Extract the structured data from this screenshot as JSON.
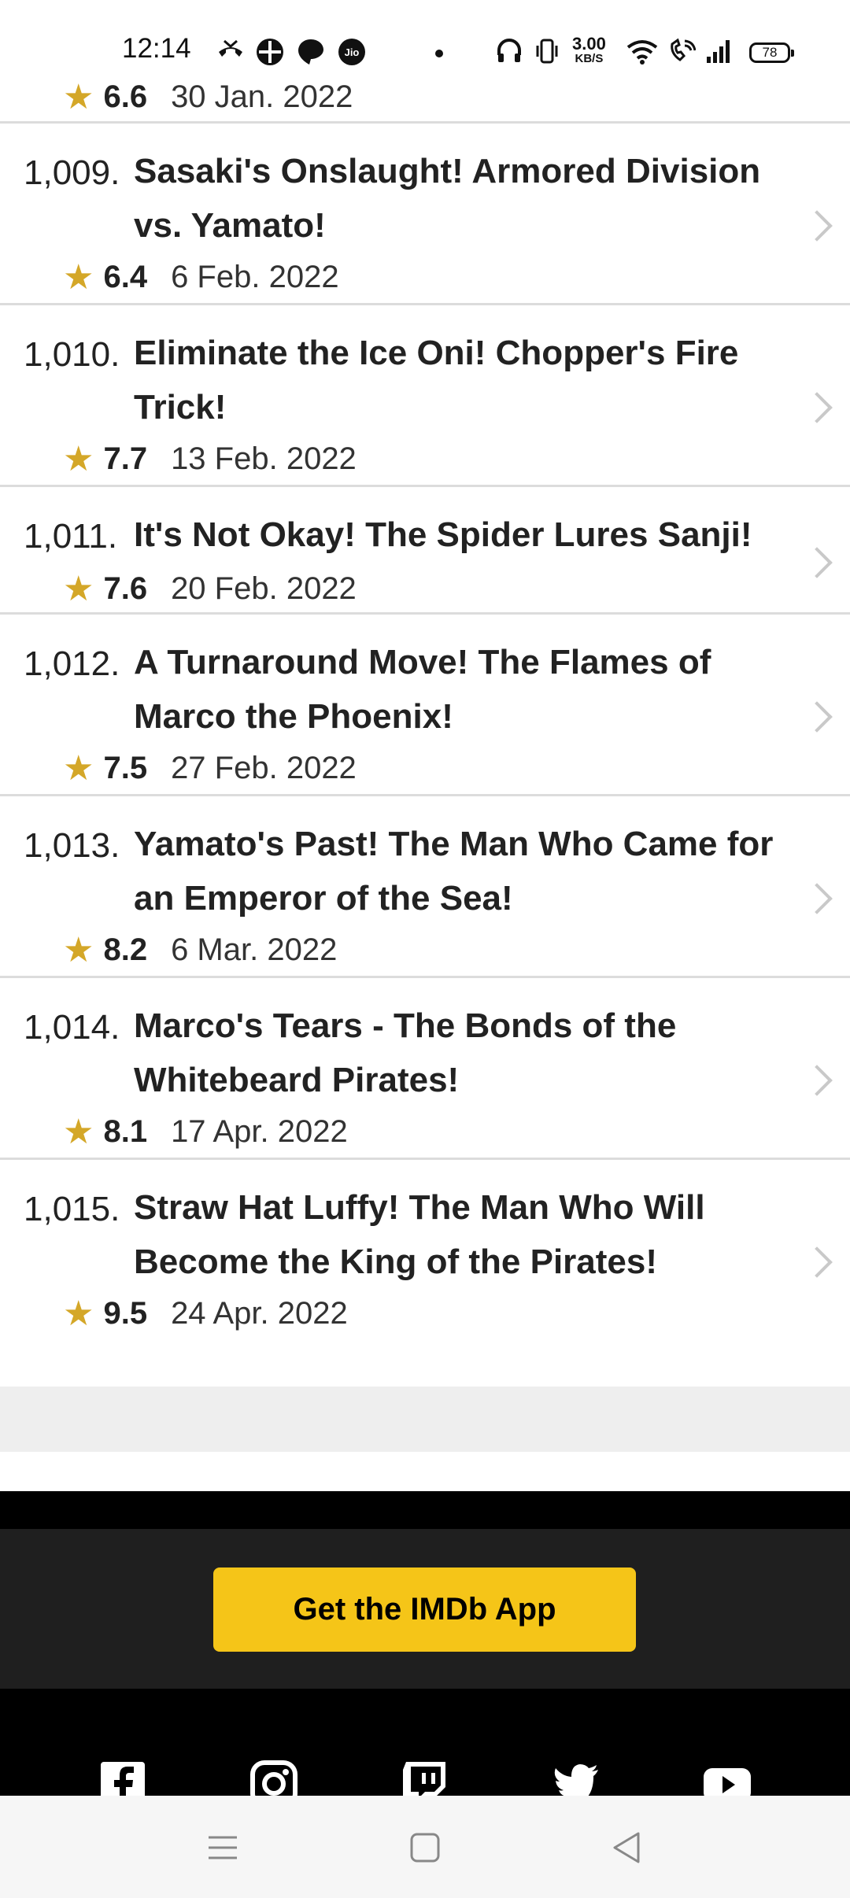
{
  "status_bar": {
    "time": "12:14",
    "speed_value": "3.00",
    "speed_unit": "KB/S",
    "battery": "78"
  },
  "episodes": [
    {
      "number": "",
      "title": "",
      "rating": "6.6",
      "date": "30 Jan. 2022"
    },
    {
      "number": "1,009.",
      "title": "Sasaki's Onslaught! Armored Division vs. Yamato!",
      "rating": "6.4",
      "date": "6 Feb. 2022"
    },
    {
      "number": "1,010.",
      "title": "Eliminate the Ice Oni! Chopper's Fire Trick!",
      "rating": "7.7",
      "date": "13 Feb. 2022"
    },
    {
      "number": "1,011.",
      "title": "It's Not Okay! The Spider Lures Sanji!",
      "rating": "7.6",
      "date": "20 Feb. 2022"
    },
    {
      "number": "1,012.",
      "title": "A Turnaround Move! The Flames of Marco the Phoenix!",
      "rating": "7.5",
      "date": "27 Feb. 2022"
    },
    {
      "number": "1,013.",
      "title": "Yamato's Past! The Man Who Came for an Emperor of the Sea!",
      "rating": "8.2",
      "date": "6 Mar. 2022"
    },
    {
      "number": "1,014.",
      "title": "Marco's Tears - The Bonds of the Whitebeard Pirates!",
      "rating": "8.1",
      "date": "17 Apr. 2022"
    },
    {
      "number": "1,015.",
      "title": "Straw Hat Luffy! The Man Who Will Become the King of the Pirates!",
      "rating": "9.5",
      "date": "24 Apr. 2022"
    }
  ],
  "footer": {
    "app_button": "Get the IMDb App",
    "social_icons": [
      "facebook-icon",
      "instagram-icon",
      "twitch-icon",
      "twitter-icon",
      "youtube-icon"
    ]
  },
  "colors": {
    "accent": "#f5c518",
    "star": "#d4a728"
  }
}
